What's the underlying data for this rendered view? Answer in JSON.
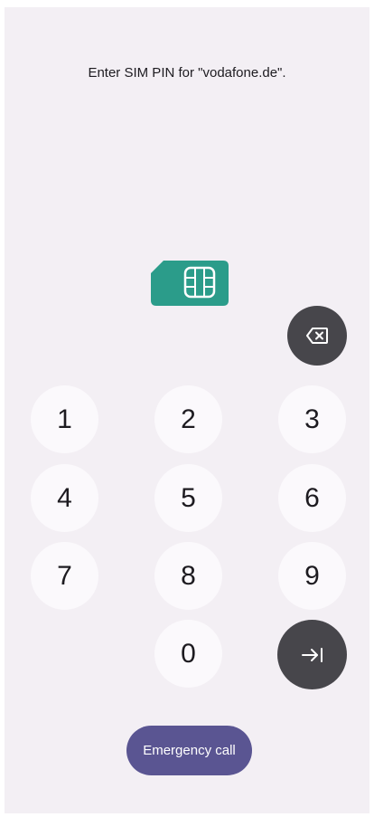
{
  "prompt": {
    "text": "Enter SIM PIN for \"vodafone.de\"."
  },
  "icons": {
    "sim": "sim-card-icon",
    "backspace": "backspace-icon",
    "enter": "enter-icon"
  },
  "keypad": {
    "keys": [
      "1",
      "2",
      "3",
      "4",
      "5",
      "6",
      "7",
      "8",
      "9",
      "0"
    ]
  },
  "emergency": {
    "label": "Emergency call"
  },
  "colors": {
    "background": "#f3eff4",
    "key_background": "#fbf9fc",
    "dark_key_background": "#47464b",
    "sim_icon": "#2b9c8a",
    "emergency_button": "#5a5592"
  }
}
